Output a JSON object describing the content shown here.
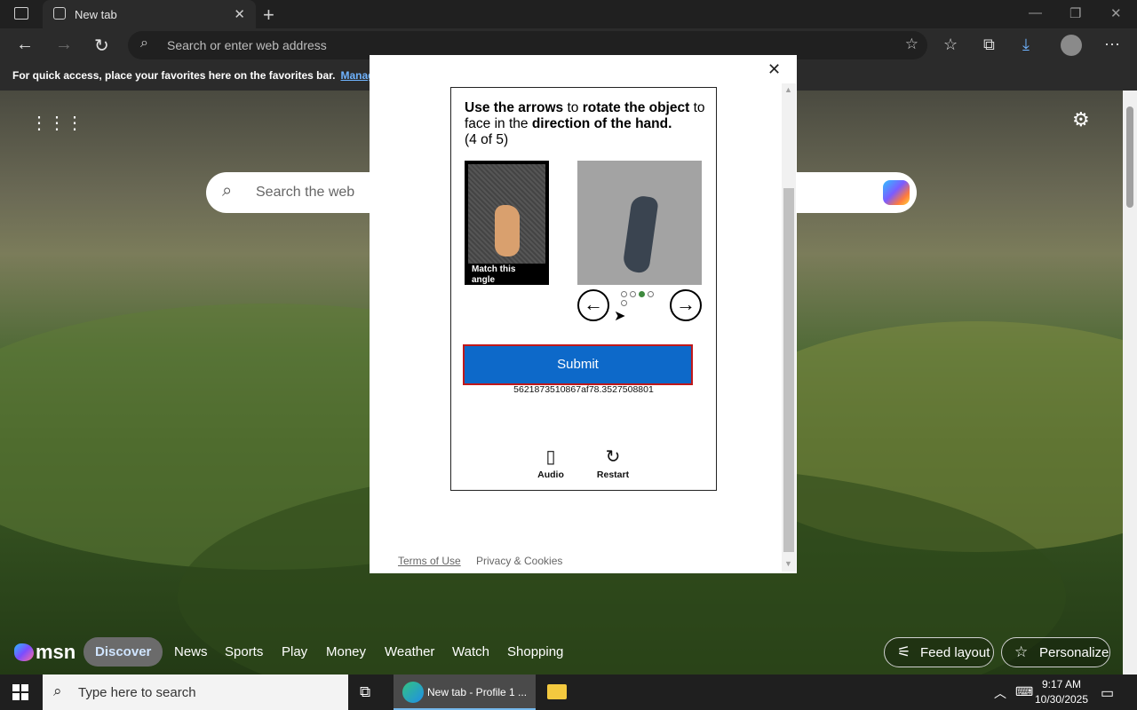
{
  "browser": {
    "tab_title": "New tab",
    "address_placeholder": "Search or enter web address",
    "favbar_text": "For quick access, place your favorites here on the favorites bar.",
    "favbar_link": "Manage fa"
  },
  "page": {
    "search_placeholder": "Search the web"
  },
  "captcha": {
    "prompt_part1": "Use the arrows",
    "prompt_part2": " to ",
    "prompt_part3": "rotate the object",
    "prompt_part4": " to face in the ",
    "prompt_part5": "direction of the hand.",
    "progress": "(4 of 5)",
    "reference_caption": "Match this angle",
    "prev_arrow": "←",
    "next_arrow": "→",
    "submit_label": "Submit",
    "token": "5621873510867af78.3527508801",
    "audio_label": "Audio",
    "restart_label": "Restart",
    "terms_link": "Terms of Use",
    "privacy_link": "Privacy & Cookies",
    "current_step": 4,
    "total_steps": 5
  },
  "msn": {
    "logo": "msn",
    "nav": [
      "Discover",
      "News",
      "Sports",
      "Play",
      "Money",
      "Weather",
      "Watch",
      "Shopping"
    ],
    "feed_layout": "Feed layout",
    "personalize": "Personalize"
  },
  "taskbar": {
    "search_placeholder": "Type here to search",
    "edge_label": "New tab - Profile 1 ...",
    "time": "9:17 AM",
    "date": "10/30/2025"
  },
  "colors": {
    "submit_bg": "#0d69c9",
    "submit_border": "#c0181a",
    "active_dot": "#3e8a3e"
  }
}
